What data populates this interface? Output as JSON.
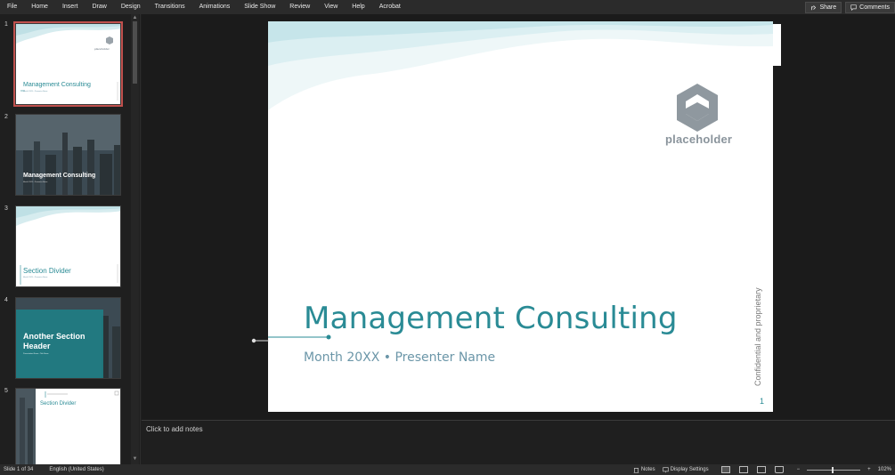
{
  "ribbon": {
    "tabs": [
      "File",
      "Home",
      "Insert",
      "Draw",
      "Design",
      "Transitions",
      "Animations",
      "Slide Show",
      "Review",
      "View",
      "Help",
      "Acrobat"
    ],
    "share_label": "Share",
    "comments_label": "Comments"
  },
  "thumbnails": [
    {
      "num": "1",
      "title": "Management Consulting",
      "subtitle": "Month 20XX • Presenter Name",
      "selected": true
    },
    {
      "num": "2",
      "title": "Management Consulting",
      "subtitle": "Month 20XX • Presenter Name"
    },
    {
      "num": "3",
      "title": "Section Divider",
      "subtitle": "Month 20XX • Presenter Name"
    },
    {
      "num": "4",
      "title": "Another Section Header",
      "subtitle": "Presentation Name • Title Name"
    },
    {
      "num": "5",
      "title": "Section Divider",
      "subtitle": ""
    }
  ],
  "slide": {
    "title": "Management Consulting",
    "subtitle": "Month 20XX • Presenter Name",
    "logo_text": "placeholder",
    "vertical_text": "Confidential and proprietary",
    "page_number": "1"
  },
  "notes": {
    "placeholder": "Click to add notes"
  },
  "status": {
    "slide_info": "Slide 1 of 34",
    "language": "English (United States)",
    "notes_label": "Notes",
    "display_label": "Display Settings",
    "zoom_minus": "−",
    "zoom_plus": "+",
    "zoom": "102%"
  },
  "colors": {
    "accent": "#2a8b95",
    "selected_outline": "#c0504d"
  }
}
